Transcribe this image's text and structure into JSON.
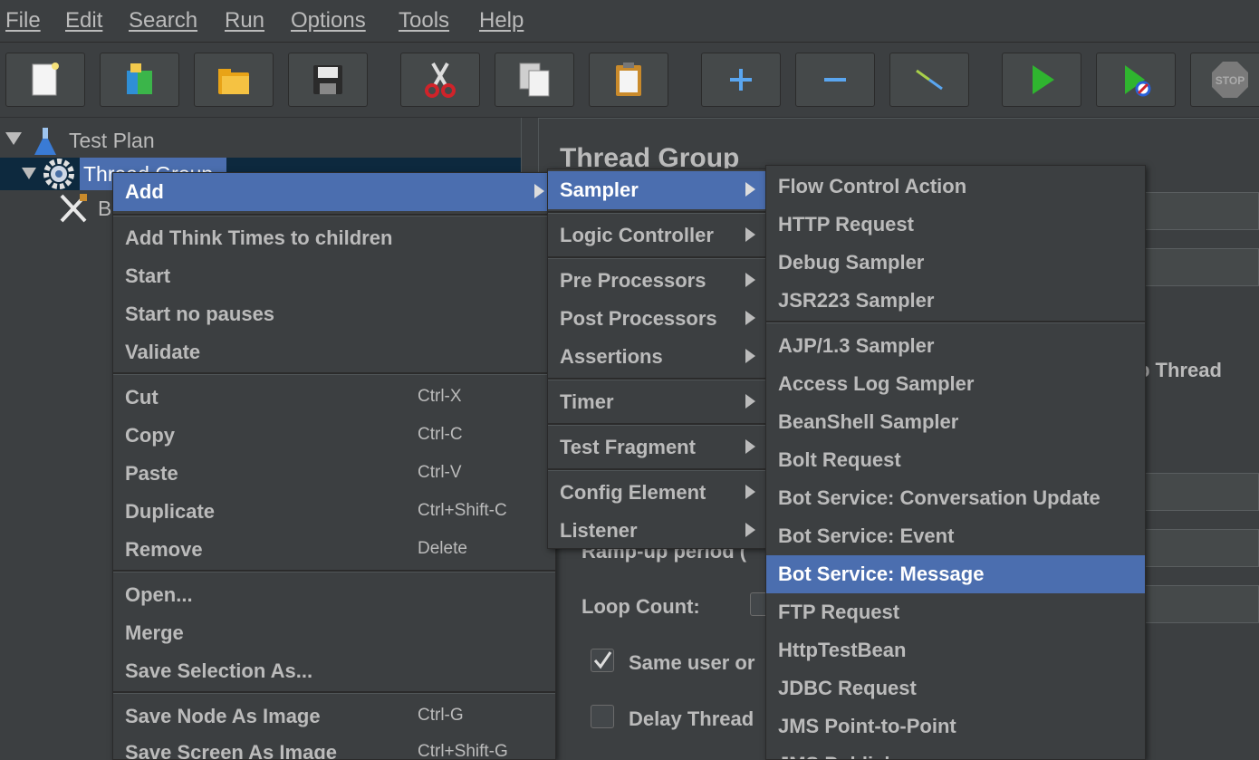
{
  "menubar": [
    "File",
    "Edit",
    "Search",
    "Run",
    "Options",
    "Tools",
    "Help"
  ],
  "toolbar": {
    "icons": [
      "new-icon",
      "templates-icon",
      "open-icon",
      "save-icon",
      "cut-icon",
      "copy-icon",
      "paste-icon",
      "expand-icon",
      "collapse-icon",
      "toggle-icon",
      "start-icon",
      "start-no-pauses-icon",
      "stop-icon"
    ],
    "stop_text": "STOP"
  },
  "tree": {
    "items": [
      {
        "label": "Test Plan",
        "icon": "flask-icon"
      },
      {
        "label": "Thread Group",
        "icon": "gear-icon"
      },
      {
        "label": "B",
        "icon": "tools-icon"
      }
    ]
  },
  "right_panel": {
    "title": "Thread Group",
    "ramp_up": "Ramp-up period (",
    "loop_count": "Loop Count:",
    "same_user": "Same user or",
    "delay_thread": "Delay Thread",
    "stop_thread": "p Thread"
  },
  "context_menu": {
    "groups": [
      [
        {
          "label": "Add",
          "submenu": true,
          "selected": true
        }
      ],
      [
        {
          "label": "Add Think Times to children"
        },
        {
          "label": "Start"
        },
        {
          "label": "Start no pauses"
        },
        {
          "label": "Validate"
        }
      ],
      [
        {
          "label": "Cut",
          "shortcut": "Ctrl-X"
        },
        {
          "label": "Copy",
          "shortcut": "Ctrl-C"
        },
        {
          "label": "Paste",
          "shortcut": "Ctrl-V"
        },
        {
          "label": "Duplicate",
          "shortcut": "Ctrl+Shift-C"
        },
        {
          "label": "Remove",
          "shortcut": "Delete"
        }
      ],
      [
        {
          "label": "Open..."
        },
        {
          "label": "Merge"
        },
        {
          "label": "Save Selection As..."
        }
      ],
      [
        {
          "label": "Save Node As Image",
          "shortcut": "Ctrl-G"
        },
        {
          "label": "Save Screen As Image",
          "shortcut": "Ctrl+Shift-G"
        }
      ]
    ]
  },
  "add_menu": {
    "groups": [
      [
        {
          "label": "Sampler",
          "selected": true
        }
      ],
      [
        {
          "label": "Logic Controller"
        }
      ],
      [
        {
          "label": "Pre Processors"
        },
        {
          "label": "Post Processors"
        },
        {
          "label": "Assertions"
        }
      ],
      [
        {
          "label": "Timer"
        }
      ],
      [
        {
          "label": "Test Fragment"
        }
      ],
      [
        {
          "label": "Config Element"
        },
        {
          "label": "Listener"
        }
      ]
    ]
  },
  "sampler_menu": {
    "groups": [
      [
        {
          "label": "Flow Control Action"
        },
        {
          "label": "HTTP Request"
        },
        {
          "label": "Debug Sampler"
        },
        {
          "label": "JSR223 Sampler"
        }
      ],
      [
        {
          "label": "AJP/1.3 Sampler"
        },
        {
          "label": "Access Log Sampler"
        },
        {
          "label": "BeanShell Sampler"
        },
        {
          "label": "Bolt Request"
        },
        {
          "label": "Bot Service: Conversation Update"
        },
        {
          "label": "Bot Service: Event"
        },
        {
          "label": "Bot Service: Message",
          "selected": true
        },
        {
          "label": "FTP Request"
        },
        {
          "label": "HttpTestBean"
        },
        {
          "label": "JDBC Request"
        },
        {
          "label": "JMS Point-to-Point"
        },
        {
          "label": "JMS Publisher"
        }
      ]
    ]
  },
  "colors": {
    "background": "#3c3f41",
    "selection": "#4b6eaf",
    "text": "#bbbbbb"
  }
}
